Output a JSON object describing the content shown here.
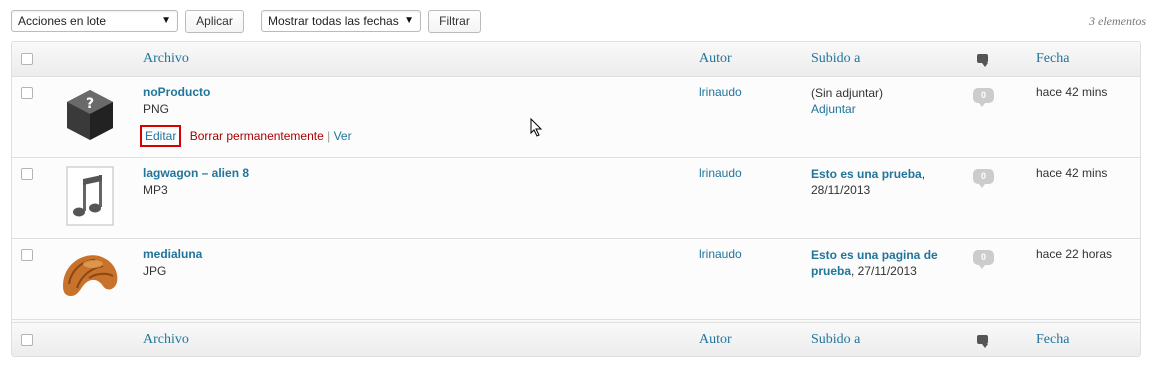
{
  "toolbar": {
    "bulk_actions": "Acciones en lote",
    "apply": "Aplicar",
    "dates_filter": "Mostrar todas las fechas",
    "filter": "Filtrar",
    "item_count": "3 elementos"
  },
  "columns": {
    "file": "Archivo",
    "author": "Autor",
    "uploaded_to": "Subido a",
    "comments_icon": "comment-bubble-icon",
    "date": "Fecha"
  },
  "rows": [
    {
      "title": "noProducto",
      "type": "PNG",
      "thumb_icon": "unknown-file-icon",
      "author": "lrinaudo",
      "uploaded_to_text": "(Sin adjuntar)",
      "uploaded_to_link": "Adjuntar",
      "comments": "0",
      "date": "hace 42 mins",
      "actions": {
        "edit": "Editar",
        "delete": "Borrar permanentemente",
        "separator": "|",
        "view": "Ver"
      }
    },
    {
      "title": "lagwagon – alien 8",
      "type": "MP3",
      "thumb_icon": "audio-file-icon",
      "author": "lrinaudo",
      "uploaded_to_post": "Esto es una prueba",
      "uploaded_to_date": ", 28/11/2013",
      "comments": "0",
      "date": "hace 42 mins"
    },
    {
      "title": "medialuna",
      "type": "JPG",
      "thumb_icon": "croissant-image",
      "author": "lrinaudo",
      "uploaded_to_post": "Esto es una pagina de prueba",
      "uploaded_to_date": ", 27/11/2013",
      "comments": "0",
      "date": "hace 22 horas"
    }
  ],
  "colors": {
    "link": "#21759b",
    "delete": "#aa0000",
    "highlight": "#d50000"
  }
}
